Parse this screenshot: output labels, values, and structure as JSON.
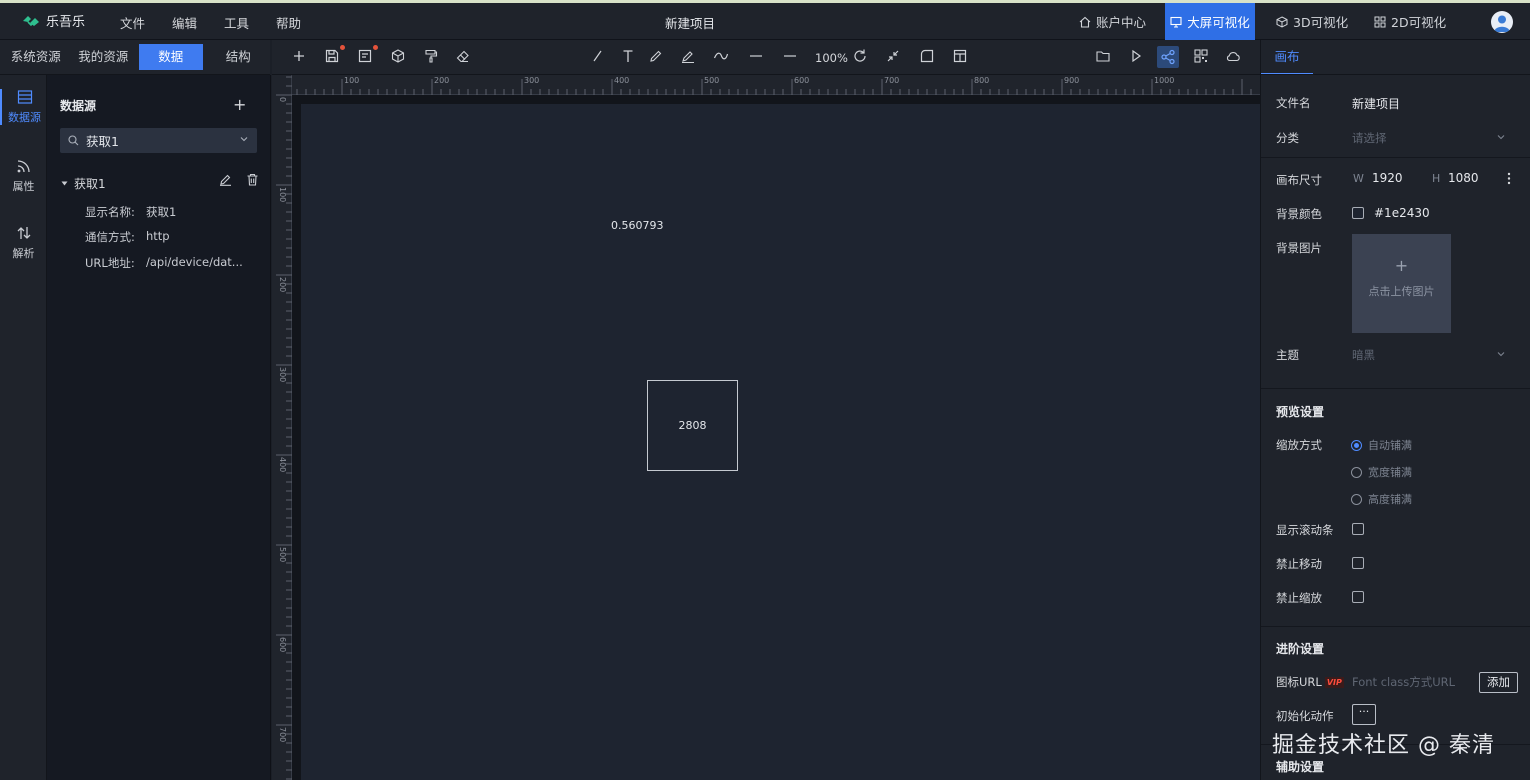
{
  "app": {
    "logo_text": "乐吾乐",
    "menus": [
      "文件",
      "编辑",
      "工具",
      "帮助"
    ],
    "doc_title": "新建项目",
    "nav": {
      "account": "账户中心",
      "bigscreen": "大屏可视化",
      "three_d": "3D可视化",
      "two_d": "2D可视化"
    }
  },
  "left_tabs": [
    "系统资源",
    "我的资源",
    "数据",
    "结构"
  ],
  "rail": [
    "数据源",
    "属性",
    "解析"
  ],
  "data_source": {
    "title": "数据源",
    "add": "+",
    "search_value": "获取1",
    "node": "获取1",
    "props": [
      {
        "k": "显示名称:",
        "v": "获取1"
      },
      {
        "k": "通信方式:",
        "v": "http"
      },
      {
        "k": "URL地址:",
        "v": "/api/device/dat..."
      }
    ]
  },
  "toolbar": {
    "zoom": "100%"
  },
  "ruler": {
    "top": [
      "100",
      "200",
      "300",
      "400",
      "500",
      "600",
      "700",
      "800",
      "900",
      "1000"
    ],
    "left": [
      "0",
      "100",
      "200",
      "300",
      "400",
      "500",
      "600",
      "700"
    ]
  },
  "canvas": {
    "text_value": "0.560793",
    "box_value": "2808"
  },
  "right_panel": {
    "tab": "画布",
    "file_name_label": "文件名",
    "file_name": "新建项目",
    "category_label": "分类",
    "category_placeholder": "请选择",
    "size_label": "画布尺寸",
    "w_label": "W",
    "w": "1920",
    "h_label": "H",
    "h": "1080",
    "bg_color_label": "背景颜色",
    "bg_color": "#1e2430",
    "bg_color_text": "#1e2430",
    "bg_image_label": "背景图片",
    "upload_plus": "+",
    "upload_text": "点击上传图片",
    "theme_label": "主题",
    "theme_value": "暗黑",
    "preview_section": "预览设置",
    "scale_label": "缩放方式",
    "scale_options": [
      "自动铺满",
      "宽度铺满",
      "高度铺满"
    ],
    "scrollbar_label": "显示滚动条",
    "nomove_label": "禁止移动",
    "nozoom_label": "禁止缩放",
    "advanced_section": "进阶设置",
    "icon_url_label": "图标URL",
    "vip": "VIP",
    "icon_url_placeholder": "Font class方式URL",
    "add_btn": "添加",
    "init_action_label": "初始化动作",
    "init_action_btn": "···",
    "aux_section": "辅助设置"
  },
  "watermark": "掘金技术社区 @ 秦清",
  "colors": {
    "accent": "#3f7bf0",
    "canvas": "#1e2430",
    "panel": "#1f232b"
  }
}
